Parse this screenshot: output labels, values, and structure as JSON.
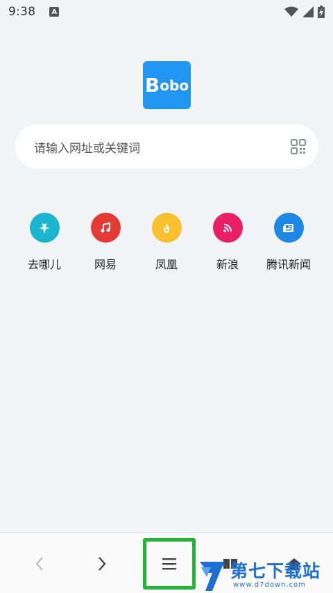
{
  "status_bar": {
    "time": "9:38",
    "notification_badge": "A"
  },
  "logo": {
    "text_first": "B",
    "text_rest": "obo",
    "color": "#2196f3"
  },
  "search": {
    "placeholder": "请输入网址或关键词",
    "qr_icon": "qr-scan-icon"
  },
  "shortcuts": [
    {
      "label": "去哪儿",
      "icon": "airplane-icon",
      "color": "#1ab6cf"
    },
    {
      "label": "网易",
      "icon": "music-note-icon",
      "color": "#e53935"
    },
    {
      "label": "凤凰",
      "icon": "fire-icon",
      "color": "#fbc02d"
    },
    {
      "label": "新浪",
      "icon": "rss-icon",
      "color": "#e91e63"
    },
    {
      "label": "腾讯新闻",
      "icon": "newspaper-icon",
      "color": "#1e88e5"
    }
  ],
  "bottom_nav": {
    "back_icon": "chevron-left-icon",
    "forward_icon": "chevron-right-icon",
    "menu_icon": "hamburger-menu-icon",
    "tabs_icon": "tabs-icon",
    "home_icon": "home-icon",
    "highlight_color": "#22b538"
  },
  "watermark": {
    "title": "第七下载站",
    "url": "www.d7down.com"
  }
}
